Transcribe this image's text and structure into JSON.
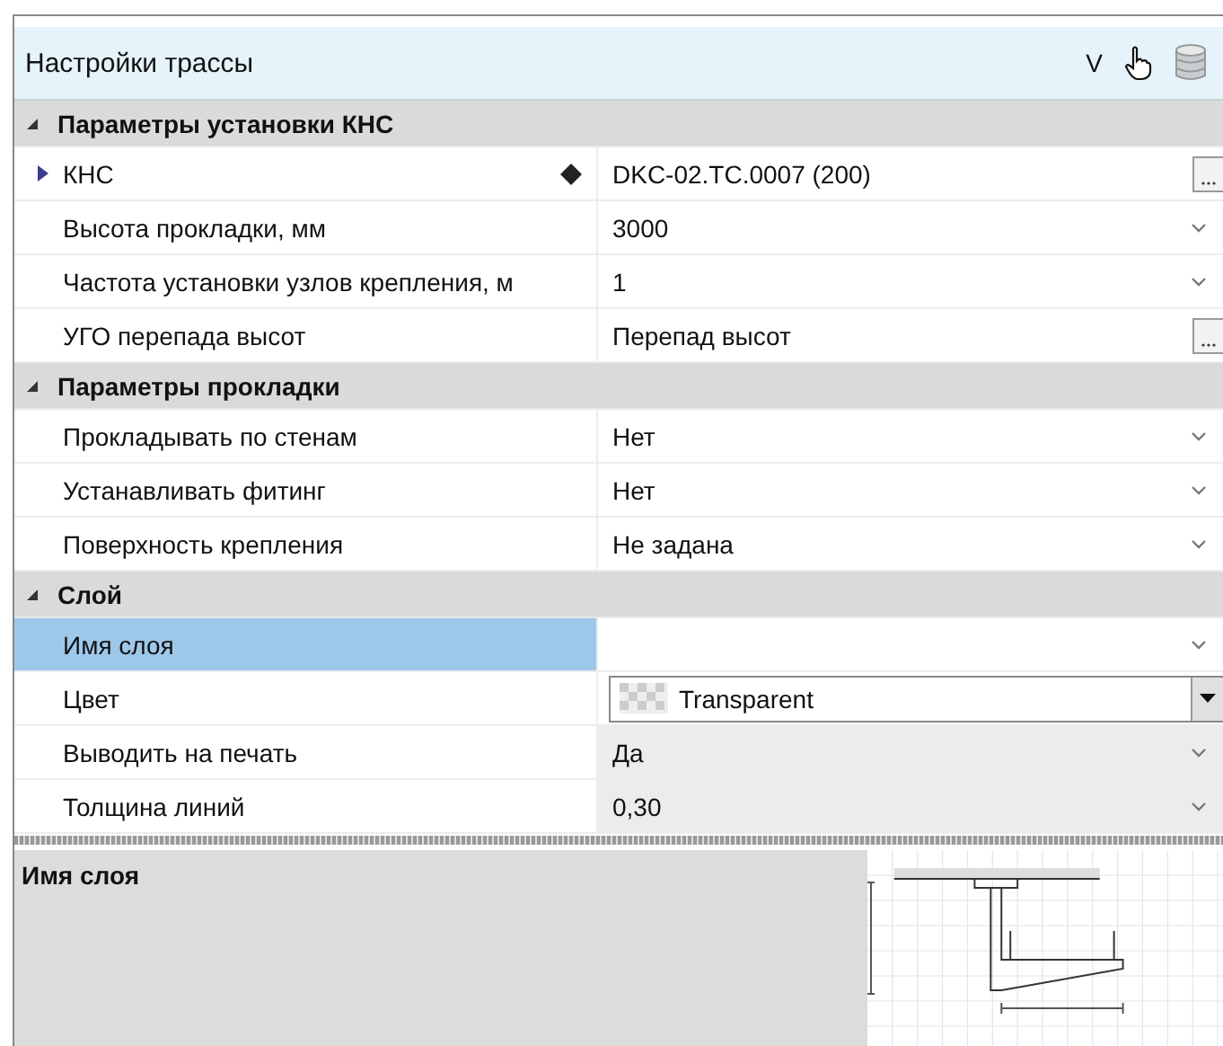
{
  "panel": {
    "title": "Настройки трассы",
    "header_letter": "V"
  },
  "categories": [
    {
      "name": "Параметры установки КНС",
      "expanded": true,
      "rows": [
        {
          "label": "КНС",
          "value": "DKC-02.TC.0007 (200)",
          "kind": "browse",
          "expandable": true,
          "marker": true,
          "selected": false,
          "read_only": false
        },
        {
          "label": "Высота прокладки, мм",
          "value": "3000",
          "kind": "dropdown",
          "expandable": false,
          "marker": false,
          "selected": false,
          "read_only": false
        },
        {
          "label": "Частота установки узлов крепления, м",
          "value": "1",
          "kind": "dropdown",
          "expandable": false,
          "marker": false,
          "selected": false,
          "read_only": false
        },
        {
          "label": "УГО перепада высот",
          "value": "Перепад высот",
          "kind": "browse",
          "expandable": false,
          "marker": false,
          "selected": false,
          "read_only": false
        }
      ]
    },
    {
      "name": "Параметры прокладки",
      "expanded": true,
      "rows": [
        {
          "label": "Прокладывать по стенам",
          "value": "Нет",
          "kind": "dropdown",
          "expandable": false,
          "marker": false,
          "selected": false,
          "read_only": false
        },
        {
          "label": "Устанавливать фитинг",
          "value": "Нет",
          "kind": "dropdown",
          "expandable": false,
          "marker": false,
          "selected": false,
          "read_only": false
        },
        {
          "label": "Поверхность крепления",
          "value": "Не задана",
          "kind": "dropdown",
          "expandable": false,
          "marker": false,
          "selected": false,
          "read_only": false
        }
      ]
    },
    {
      "name": "Слой",
      "expanded": true,
      "rows": [
        {
          "label": "Имя слоя",
          "kind": "dropdown",
          "expandable": false,
          "marker": false,
          "selected": true,
          "read_only": false
        },
        {
          "label": "Цвет",
          "value": "Transparent",
          "kind": "color",
          "expandable": false,
          "marker": false,
          "selected": false,
          "read_only": false
        },
        {
          "label": "Выводить на печать",
          "value": "Да",
          "kind": "dropdown",
          "expandable": false,
          "marker": false,
          "selected": false,
          "read_only": true
        },
        {
          "label": "Толщина линий",
          "value": "0,30",
          "kind": "dropdown",
          "expandable": false,
          "marker": false,
          "selected": false,
          "read_only": true
        }
      ]
    }
  ],
  "description": {
    "title": "Имя слоя"
  }
}
